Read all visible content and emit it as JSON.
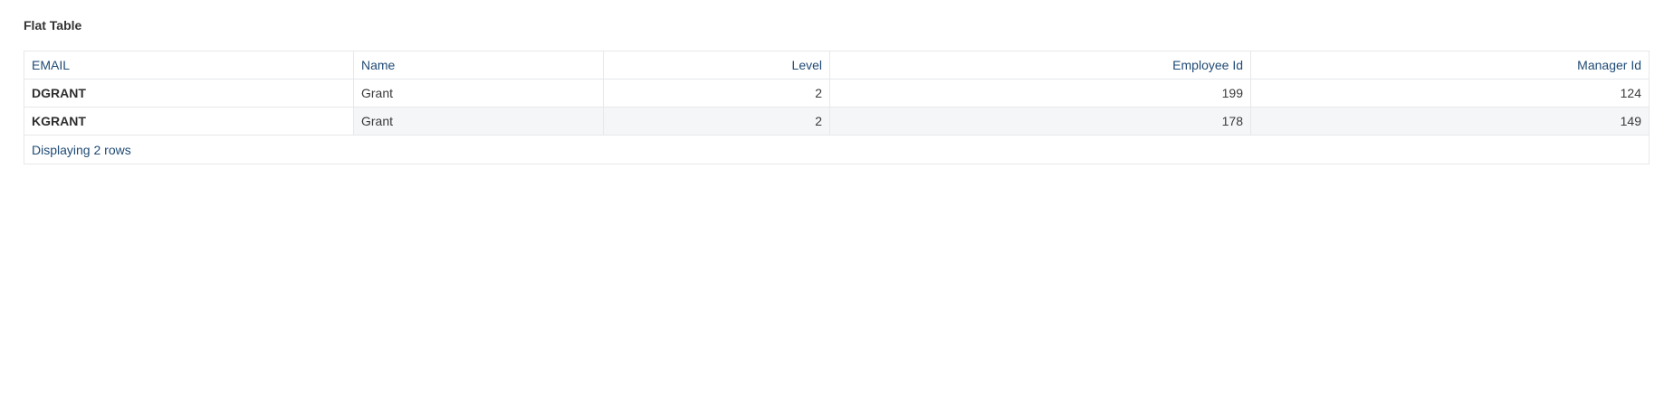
{
  "title": "Flat Table",
  "table": {
    "columns": [
      "EMAIL",
      "Name",
      "Level",
      "Employee Id",
      "Manager Id"
    ],
    "rows": [
      {
        "email": "DGRANT",
        "name": "Grant",
        "level": "2",
        "employee_id": "199",
        "manager_id": "124"
      },
      {
        "email": "KGRANT",
        "name": "Grant",
        "level": "2",
        "employee_id": "178",
        "manager_id": "149"
      }
    ],
    "footer": "Displaying 2 rows"
  }
}
